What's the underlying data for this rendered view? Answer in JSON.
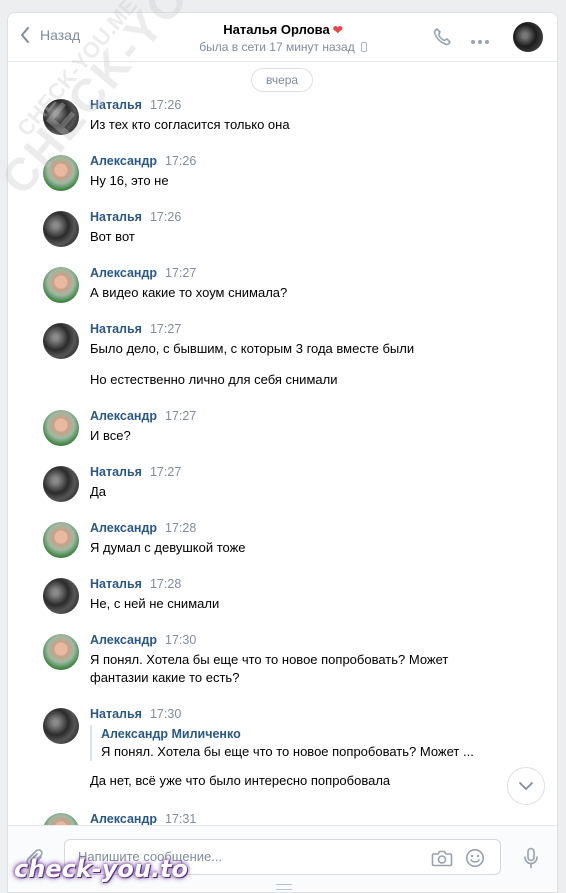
{
  "header": {
    "back_label": "Назад",
    "title": "Наталья Орлова",
    "title_icon": "❤",
    "status": "была в сети 17 минут назад"
  },
  "history": {
    "date_separator": "вчера",
    "messages": [
      {
        "author": "Наталья",
        "time": "17:26",
        "text": "Из тех кто согласится только она"
      },
      {
        "author": "Александр",
        "time": "17:26",
        "text": "Ну 16, это не"
      },
      {
        "author": "Наталья",
        "time": "17:26",
        "text": "Вот вот"
      },
      {
        "author": "Александр",
        "time": "17:27",
        "text": "А видео какие то хоум снимала?"
      },
      {
        "author": "Наталья",
        "time": "17:27",
        "text": "Было дело, с бывшим, с которым 3 года вместе были",
        "text2": "Но естественно лично для себя снимали"
      },
      {
        "author": "Александр",
        "time": "17:27",
        "text": "И все?"
      },
      {
        "author": "Наталья",
        "time": "17:27",
        "text": "Да"
      },
      {
        "author": "Александр",
        "time": "17:28",
        "text": "Я думал с девушкой тоже"
      },
      {
        "author": "Наталья",
        "time": "17:28",
        "text": "Не, с ней не снимали"
      },
      {
        "author": "Александр",
        "time": "17:30",
        "text": "Я понял. Хотела бы еще что то новое попробовать? Может фантазии какие то есть?"
      },
      {
        "author": "Наталья",
        "time": "17:30",
        "quote_author": "Александр Миличенко",
        "quote_text": "Я понял. Хотела бы еще что то новое попробовать? Может ...",
        "text": "Да нет, всё уже что было интересно попробовала"
      },
      {
        "author": "Александр",
        "time": "17:31"
      }
    ]
  },
  "composer": {
    "placeholder": "Напишите сообщение..."
  },
  "watermarks": {
    "diagonal": "CHECK-YOU.ME",
    "logo": "check-you.to"
  }
}
